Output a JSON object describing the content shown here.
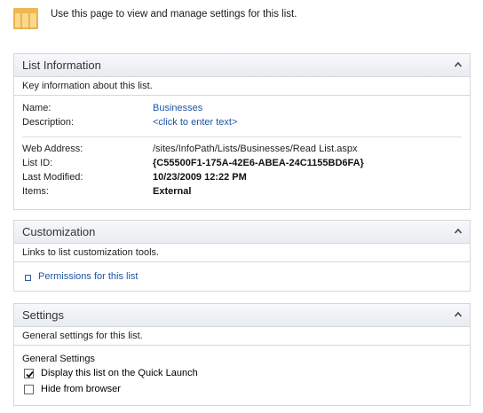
{
  "intro": "Use this page to view and manage settings for this list.",
  "list_info": {
    "title": "List Information",
    "description": "Key information about this list.",
    "name_label": "Name:",
    "name_value": "Businesses",
    "description_label": "Description:",
    "description_value": "<click to enter text>",
    "web_address_label": "Web Address:",
    "web_address_value": "/sites/InfoPath/Lists/Businesses/Read List.aspx",
    "list_id_label": "List ID:",
    "list_id_value": "{C55500F1-175A-42E6-ABEA-24C1155BD6FA}",
    "last_modified_label": "Last Modified:",
    "last_modified_value": "10/23/2009 12:22 PM",
    "items_label": "Items:",
    "items_value": "External"
  },
  "customization": {
    "title": "Customization",
    "description": "Links to list customization tools.",
    "permissions_link": "Permissions for this list"
  },
  "settings": {
    "title": "Settings",
    "description": "General settings for this list.",
    "group_label": "General Settings",
    "quick_launch_label": "Display this list on the Quick Launch",
    "quick_launch_checked": true,
    "hide_browser_label": "Hide from browser",
    "hide_browser_checked": false
  }
}
